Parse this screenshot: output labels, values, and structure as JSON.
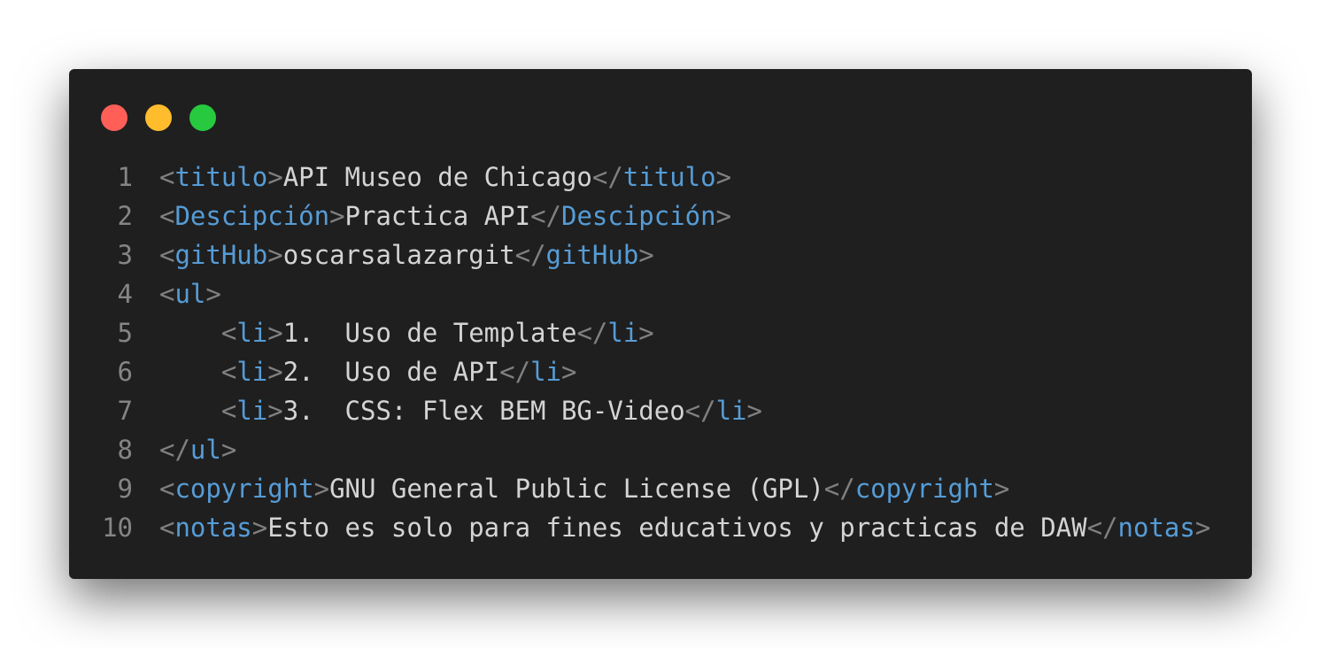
{
  "window": {
    "controls": [
      {
        "name": "close",
        "color": "#ff5f56"
      },
      {
        "name": "minimize",
        "color": "#ffbd2e"
      },
      {
        "name": "maximize",
        "color": "#27c93f"
      }
    ],
    "background": "#1f1f1f"
  },
  "colors": {
    "tag": "#569cd6",
    "punctuation": "#808080",
    "text": "#d4d4d4",
    "line_number": "#858585"
  },
  "code": {
    "lines": [
      {
        "n": "1",
        "indent": "",
        "tag": "titulo",
        "open_close": true,
        "text": "API Museo de Chicago"
      },
      {
        "n": "2",
        "indent": "",
        "tag": "Descipción",
        "open_close": true,
        "text": "Practica API"
      },
      {
        "n": "3",
        "indent": "",
        "tag": "gitHub",
        "open_close": true,
        "text": "oscarsalazargit"
      },
      {
        "n": "4",
        "indent": "",
        "tag": "ul",
        "open_only": true
      },
      {
        "n": "5",
        "indent": "    ",
        "tag": "li",
        "open_close": true,
        "text": "1.  Uso de Template"
      },
      {
        "n": "6",
        "indent": "    ",
        "tag": "li",
        "open_close": true,
        "text": "2.  Uso de API"
      },
      {
        "n": "7",
        "indent": "    ",
        "tag": "li",
        "open_close": true,
        "text": "3.  CSS: Flex BEM BG-Video"
      },
      {
        "n": "8",
        "indent": "",
        "tag": "ul",
        "close_only": true
      },
      {
        "n": "9",
        "indent": "",
        "tag": "copyright",
        "open_close": true,
        "text": "GNU General Public License (GPL)"
      },
      {
        "n": "10",
        "indent": "",
        "tag": "notas",
        "open_close": true,
        "text": "Esto es solo para fines educativos y practicas de DAW"
      }
    ]
  }
}
